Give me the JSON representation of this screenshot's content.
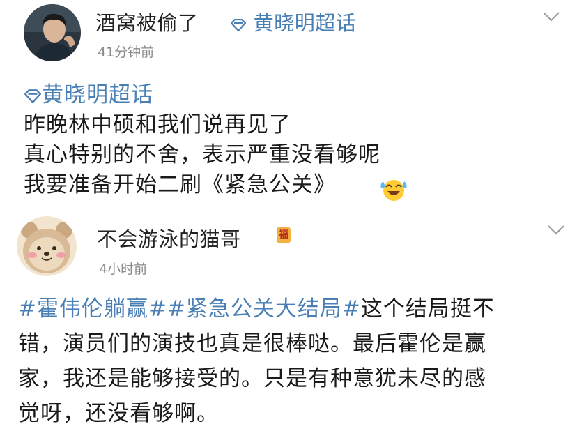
{
  "post1": {
    "username": "酒窝被偷了",
    "supertopic_label": "黄晓明超话",
    "time": "41分钟前",
    "topic_link": "黄晓明超话",
    "lines": [
      "昨晚林中硕和我们说再见了",
      "真心特别的不舍，表示严重没看够呢",
      "我要准备开始二刷《紧急公关》"
    ],
    "emoji": "laugh-cry-emoji"
  },
  "post2": {
    "username": "不会游泳的猫哥",
    "badge": "福",
    "time": "4小时前",
    "hashtag1": "#霍伟伦躺赢#",
    "hashtag2": "#紧急公关大结局#",
    "line1_rest": "这个结局挺不",
    "lines": [
      "错，演员们的演技也真是很棒哒。最后霍伦是赢",
      "家，我还是能够接受的。只是有种意犹未尽的感",
      "觉呀，还没看够啊。"
    ]
  },
  "colors": {
    "link": "#4a7fb5",
    "meta": "#8a8a8a",
    "badge": "#f5b042"
  }
}
